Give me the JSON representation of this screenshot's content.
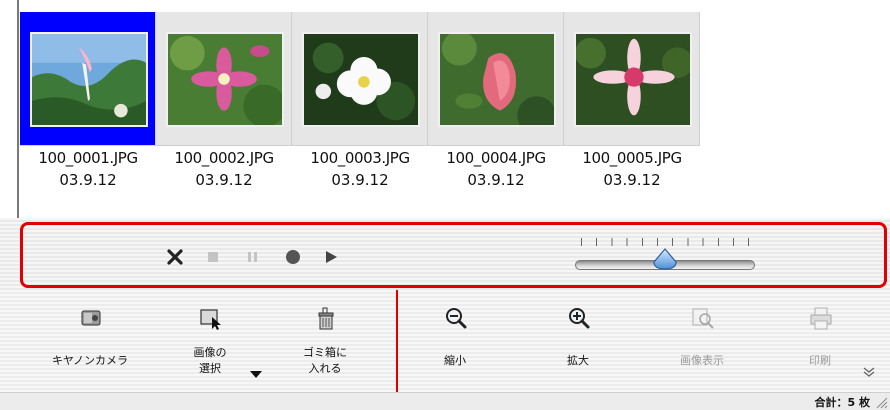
{
  "thumbnails": [
    {
      "filename": "100_0001.JPG",
      "date": "03.9.12",
      "selected": true
    },
    {
      "filename": "100_0002.JPG",
      "date": "03.9.12",
      "selected": false
    },
    {
      "filename": "100_0003.JPG",
      "date": "03.9.12",
      "selected": false
    },
    {
      "filename": "100_0004.JPG",
      "date": "03.9.12",
      "selected": false
    },
    {
      "filename": "100_0005.JPG",
      "date": "03.9.12",
      "selected": false
    }
  ],
  "controls": {
    "icons": [
      "close-x-icon",
      "stop-icon",
      "pause-icon",
      "record-icon",
      "play-icon"
    ],
    "slider_position": 0.5
  },
  "toolbar": {
    "left": [
      {
        "icon": "canon-camera-icon",
        "label": "キヤノンカメラ"
      },
      {
        "icon": "select-image-icon",
        "label1": "画像の",
        "label2": "選択"
      },
      {
        "icon": "trash-icon",
        "label1": "ゴミ箱に",
        "label2": "入れる"
      }
    ],
    "right": [
      {
        "icon": "zoom-out-icon",
        "label": "縮小",
        "enabled": true
      },
      {
        "icon": "zoom-in-icon",
        "label": "拡大",
        "enabled": true
      },
      {
        "icon": "view-image-icon",
        "label": "画像表示",
        "enabled": false
      },
      {
        "icon": "print-icon",
        "label": "印刷",
        "enabled": false
      }
    ]
  },
  "status": {
    "total": "合計：5 枚"
  },
  "colors": {
    "selection": "#0000ff",
    "highlight": "#e00000"
  }
}
